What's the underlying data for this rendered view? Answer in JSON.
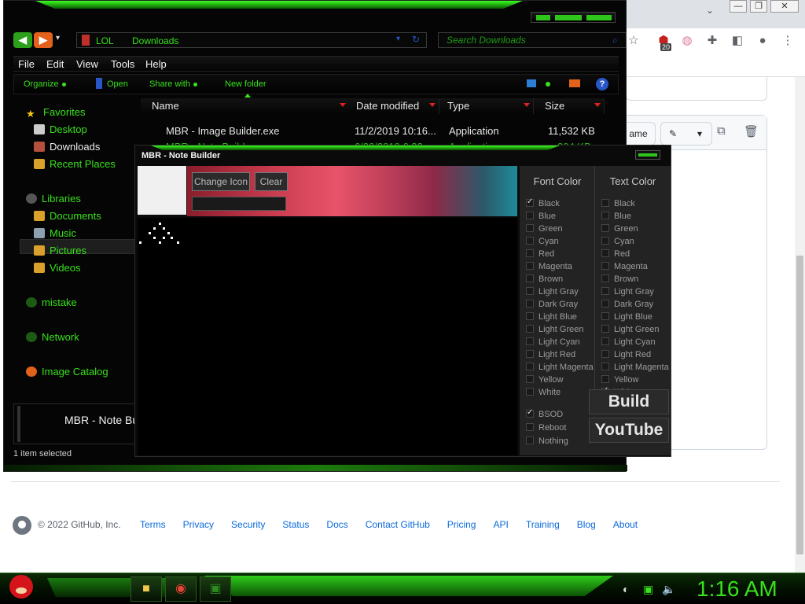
{
  "chrome": {
    "chevron": "⌄",
    "window_controls": [
      "—",
      "❐",
      "✕"
    ],
    "extension_badge": "20",
    "toolbar_icons": [
      "star-icon",
      "extension-icon",
      "puzzle-icon",
      "sidepanel-icon",
      "profile-icon",
      "menu-icon"
    ]
  },
  "github": {
    "rename_label": "ame",
    "footer": {
      "copyright": "© 2022 GitHub, Inc.",
      "links": [
        "Terms",
        "Privacy",
        "Security",
        "Status",
        "Docs",
        "Contact GitHub",
        "Pricing",
        "API",
        "Training",
        "Blog",
        "About"
      ]
    }
  },
  "explorer": {
    "breadcrumb": [
      "LOL",
      "Downloads"
    ],
    "search_placeholder": "Search Downloads",
    "menu": [
      "File",
      "Edit",
      "View",
      "Tools",
      "Help"
    ],
    "commands": [
      "Organize",
      "Open",
      "Share with",
      "New folder"
    ],
    "nav": {
      "favorites": "Favorites",
      "desktop": "Desktop",
      "downloads": "Downloads",
      "recent": "Recent Places",
      "libraries": "Libraries",
      "documents": "Documents",
      "music": "Music",
      "pictures": "Pictures",
      "videos": "Videos",
      "mistake": "mistake",
      "network": "Network",
      "image_catalog": "Image Catalog"
    },
    "columns": [
      "Name",
      "Date modified",
      "Type",
      "Size"
    ],
    "rows": [
      {
        "name": "MBR - Image Builder.exe",
        "date": "11/2/2019 10:16...",
        "type": "Application",
        "size": "11,532 KB"
      },
      {
        "name": "MBR - Note Builder.exe",
        "date": "6/30/2019 6:32 ...",
        "type": "Application",
        "size": "304 KB"
      }
    ],
    "detail_name": "MBR - Note Bu",
    "status": "1 item selected"
  },
  "note_builder": {
    "title": "MBR - Note Builder",
    "change_icon": "Change Icon",
    "clear": "Clear",
    "font_color_header": "Font Color",
    "text_color_header": "Text Color",
    "colors": [
      "Black",
      "Blue",
      "Green",
      "Cyan",
      "Red",
      "Magenta",
      "Brown",
      "Light Gray",
      "Dark Gray",
      "Light Blue",
      "Light Green",
      "Light Cyan",
      "Light Red",
      "Light Magenta",
      "Yellow",
      "White"
    ],
    "font_color_checked": [
      true,
      false,
      false,
      false,
      false,
      false,
      false,
      false,
      false,
      false,
      false,
      false,
      false,
      false,
      false,
      false
    ],
    "text_color_checked": [
      false,
      false,
      false,
      false,
      false,
      false,
      false,
      false,
      false,
      false,
      false,
      false,
      false,
      false,
      false,
      true
    ],
    "options": [
      {
        "label": "BSOD",
        "checked": true
      },
      {
        "label": "Reboot",
        "checked": false
      },
      {
        "label": "Nothing",
        "checked": false
      }
    ],
    "build_label": "Build",
    "youtube_label": "YouTube"
  },
  "taskbar": {
    "clock": "1:16 AM",
    "apps": [
      "folder-icon",
      "chrome-icon",
      "app-icon"
    ],
    "tray_icons": [
      "network-icon",
      "battery-icon",
      "volume-icon"
    ]
  },
  "colors": {
    "accent_green": "#38e21c",
    "explorer_bg": "#050505",
    "github_link": "#0969da"
  }
}
